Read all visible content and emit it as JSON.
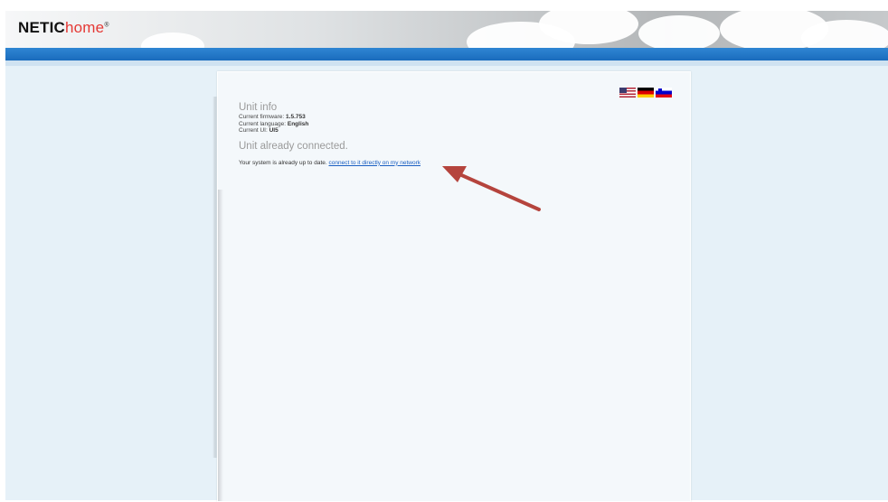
{
  "header": {
    "logo_part1": "NETIC",
    "logo_part2": "home",
    "logo_mark": "®"
  },
  "languages": [
    {
      "name": "English",
      "icon": "us-flag-icon"
    },
    {
      "name": "German",
      "icon": "german-flag-icon"
    },
    {
      "name": "Slovenian",
      "icon": "slovenian-flag-icon"
    }
  ],
  "unit_info": {
    "title": "Unit info",
    "firmware_label": "Current firmware:",
    "firmware_value": "1.5.753",
    "language_label": "Current language:",
    "language_value": "English",
    "ui_label": "Current UI:",
    "ui_value": "UI5"
  },
  "status": {
    "title": "Unit already connected.",
    "message": "Your system is already up to date.",
    "link_text": "connect to it directly on my network"
  },
  "colors": {
    "accent_blue": "#1a6bbd",
    "logo_red": "#e53935",
    "link": "#1a5fc2",
    "annotation_arrow": "#b5443d"
  }
}
